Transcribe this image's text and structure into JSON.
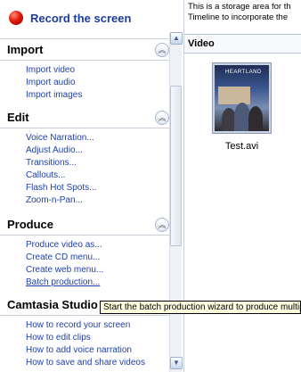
{
  "record": {
    "label": "Record the screen"
  },
  "clip_bin": {
    "note_lines": [
      "This is a storage area for th",
      "Timeline to incorporate the"
    ],
    "header": "Video",
    "clip_name": "Test.avi",
    "thumbnail_logo": "HEARTLAND"
  },
  "sections": {
    "import": {
      "title": "Import",
      "items": [
        "Import video",
        "Import audio",
        "Import images"
      ]
    },
    "edit": {
      "title": "Edit",
      "items": [
        "Voice Narration...",
        "Adjust Audio...",
        "Transitions...",
        "Callouts...",
        "Flash Hot Spots...",
        "Zoom-n-Pan..."
      ]
    },
    "produce": {
      "title": "Produce",
      "items": [
        "Produce video as...",
        "Create CD menu...",
        "Create web menu...",
        "Batch production..."
      ]
    },
    "help": {
      "title": "Camtasia Studio T",
      "items": [
        "How to record your screen",
        "How to edit clips",
        "How to add voice narration",
        "How to save and share videos"
      ]
    }
  },
  "tooltip": "Start the batch production wizard to produce multip",
  "icons": {
    "record": "record-dot-icon",
    "collapse": "chevron-double-up-icon",
    "scroll_up": "scroll-up-arrow-icon",
    "scroll_down": "scroll-down-arrow-icon"
  },
  "colors": {
    "link": "#1e3fa8",
    "record_title": "#1b3c9c",
    "tooltip_bg": "#ffffe1"
  }
}
